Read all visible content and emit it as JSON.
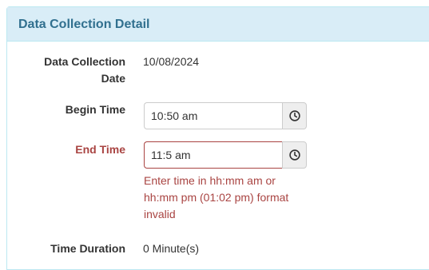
{
  "panel": {
    "title": "Data Collection Detail"
  },
  "fields": {
    "collection_date": {
      "label_line1": "Data Collection",
      "label_line2": "Date",
      "value": "10/08/2024"
    },
    "begin_time": {
      "label": "Begin Time",
      "value": "10:50 am",
      "icon": "clock-icon"
    },
    "end_time": {
      "label": "End Time",
      "value": "11:5 am",
      "icon": "clock-icon",
      "error_line1": "Enter time in hh:mm am or",
      "error_line2": "hh:mm pm (01:02 pm) format",
      "error_line3": "invalid"
    },
    "time_duration": {
      "label": "Time Duration",
      "value": "0 Minute(s)"
    }
  },
  "colors": {
    "heading_bg": "#d9edf7",
    "heading_text": "#31708f",
    "error": "#a94442"
  }
}
